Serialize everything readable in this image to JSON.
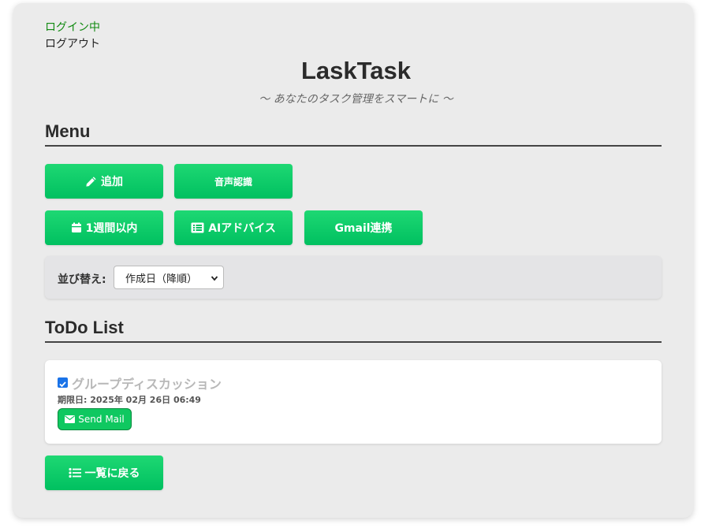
{
  "header": {
    "login_status": "ログイン中",
    "logout_label": "ログアウト",
    "app_title": "LaskTask",
    "subtitle": "〜 あなたのタスク管理をスマートに 〜"
  },
  "menu": {
    "heading": "Menu",
    "buttons": [
      {
        "label": "追加",
        "icon": "pencil-icon"
      },
      {
        "label": "音声認識",
        "icon": ""
      },
      {
        "label": "1週間以内",
        "icon": "calendar-icon"
      },
      {
        "label": "AIアドバイス",
        "icon": "list-alt-icon"
      },
      {
        "label": "Gmail連携",
        "icon": ""
      }
    ]
  },
  "sort": {
    "label": "並び替え:",
    "selected": "作成日（降順）"
  },
  "todo": {
    "heading": "ToDo List",
    "items": [
      {
        "title": "グループディスカッション",
        "checked": true,
        "due": "期限日: 2025年 02月 26日 06:49",
        "send_mail_label": "Send Mail"
      }
    ]
  },
  "back_button": {
    "label": "一覧に戻る",
    "icon": "list-icon"
  },
  "colors": {
    "button_green": "#00c060",
    "card_bg": "#ebebeb",
    "login_status": "#118a11",
    "done_text": "#b8b8b8"
  }
}
